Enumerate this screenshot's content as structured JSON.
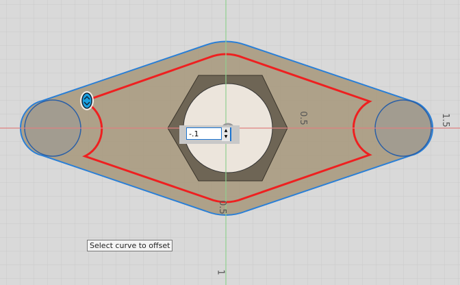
{
  "sketch": {
    "dimensions": [
      "0.5",
      "1.5",
      "0.5",
      "1"
    ],
    "offset_input": {
      "value": "-.1"
    },
    "tooltip": "Select curve to offset",
    "colors": {
      "profile_fill": "#a89a80",
      "outline": "#2a7fd6",
      "offset_curve": "#ee2020",
      "x_axis": "#e08080",
      "y_axis": "#8fd08f"
    }
  }
}
